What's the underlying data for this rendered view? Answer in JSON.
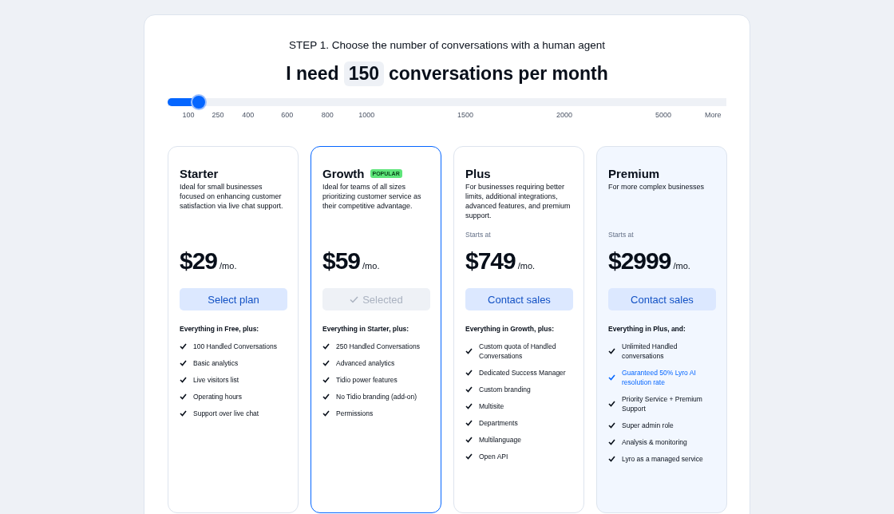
{
  "step_title": "STEP 1. Choose the number of conversations with a human agent",
  "headline": {
    "before": "I need",
    "value": "150",
    "after": "conversations per month"
  },
  "slider": {
    "level": 0.056,
    "ticks": [
      "100",
      "250",
      "400",
      "600",
      "800",
      "1000",
      "1500",
      "2000",
      "5000",
      "More"
    ]
  },
  "plans": [
    {
      "name": "Starter",
      "description": "Ideal for small businesses focused on enhancing customer satisfaction via live chat support.",
      "price": "$29",
      "period": "/mo.",
      "button": "Select plan",
      "selected": false,
      "highlighted": false,
      "features_title": "Everything in Free, plus:",
      "features": [
        {
          "text": "100 Handled Conversations",
          "kind": "standard"
        },
        {
          "text": "Basic analytics",
          "kind": "standard"
        },
        {
          "text": "Live visitors list",
          "kind": "standard"
        },
        {
          "text": "Operating hours",
          "kind": "standard"
        },
        {
          "text": "Support over live chat",
          "kind": "standard"
        }
      ]
    },
    {
      "name": "Growth",
      "badge": "POPULAR",
      "description": "Ideal for teams of all sizes prioritizing customer service as their competitive advantage.",
      "price": "$59",
      "period": "/mo.",
      "button": "Selected",
      "selected": true,
      "highlighted": false,
      "features_title": "Everything in Starter, plus:",
      "features": [
        {
          "text": "250 Handled Conversations",
          "kind": "standard"
        },
        {
          "text": "Advanced analytics",
          "kind": "standard"
        },
        {
          "text": "Tidio power features",
          "kind": "standard"
        },
        {
          "text": "No Tidio branding (add-on)",
          "kind": "standard"
        },
        {
          "text": "Permissions",
          "kind": "standard"
        }
      ]
    },
    {
      "name": "Plus",
      "description": "For businesses requiring better limits, additional integrations, advanced features, and premium support.",
      "starts_at": "Starts at",
      "price": "$749",
      "period": "/mo.",
      "button": "Contact sales",
      "selected": false,
      "highlighted": false,
      "features_title": "Everything in Growth, plus:",
      "features": [
        {
          "text": "Custom quota of Handled Conversations",
          "kind": "standard"
        },
        {
          "text": "Dedicated Success Manager",
          "kind": "standard"
        },
        {
          "text": "Custom branding",
          "kind": "standard"
        },
        {
          "text": "Multisite",
          "kind": "standard"
        },
        {
          "text": "Departments",
          "kind": "standard"
        },
        {
          "text": "Multilanguage",
          "kind": "standard"
        },
        {
          "text": "Open API",
          "kind": "standard"
        }
      ]
    },
    {
      "name": "Premium",
      "description": "For more complex businesses",
      "starts_at": "Starts at",
      "price": "$2999",
      "period": "/mo.",
      "button": "Contact sales",
      "selected": false,
      "highlighted": true,
      "features_title": "Everything in Plus, and:",
      "features": [
        {
          "text": "Unlimited Handled conversations",
          "kind": "standard"
        },
        {
          "text": "Guaranteed 50% Lyro AI resolution rate",
          "kind": "highlight"
        },
        {
          "text": "Priority Service + Premium Support",
          "kind": "standard"
        },
        {
          "text": "Super admin role",
          "kind": "standard"
        },
        {
          "text": "Analysis & monitoring",
          "kind": "standard"
        },
        {
          "text": "Lyro as a managed service",
          "kind": "standard"
        }
      ]
    }
  ]
}
